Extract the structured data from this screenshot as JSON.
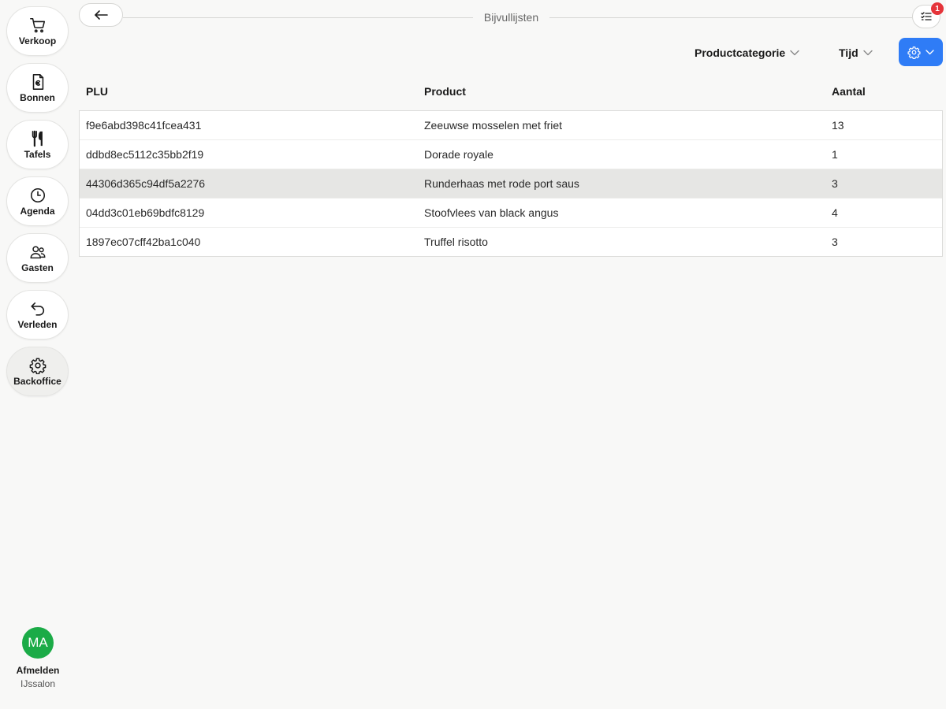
{
  "sidebar": {
    "items": [
      {
        "id": "verkoop",
        "label": "Verkoop",
        "icon": "cart-icon"
      },
      {
        "id": "bonnen",
        "label": "Bonnen",
        "icon": "receipt-euro-icon"
      },
      {
        "id": "tafels",
        "label": "Tafels",
        "icon": "cutlery-icon"
      },
      {
        "id": "agenda",
        "label": "Agenda",
        "icon": "clock-icon"
      },
      {
        "id": "gasten",
        "label": "Gasten",
        "icon": "users-icon"
      },
      {
        "id": "verleden",
        "label": "Verleden",
        "icon": "undo-arrow-icon"
      },
      {
        "id": "backoffice",
        "label": "Backoffice",
        "icon": "gear-icon"
      }
    ],
    "active": "backoffice",
    "user": {
      "initials": "MA",
      "avatar_color": "#1bab47",
      "logout_label": "Afmelden",
      "venue": "IJssalon"
    }
  },
  "header": {
    "title": "Bijvullijsten",
    "notification_count": "1"
  },
  "filters": {
    "category_label": "Productcategorie",
    "time_label": "Tijd"
  },
  "colors": {
    "accent": "#2f7cf6",
    "badge": "#e5343a",
    "avatar": "#1bab47"
  },
  "table": {
    "columns": [
      "PLU",
      "Product",
      "Aantal"
    ],
    "rows": [
      {
        "plu": "f9e6abd398c41fcea431",
        "product": "Zeeuwse mosselen met friet",
        "qty": "13",
        "selected": false
      },
      {
        "plu": "ddbd8ec5112c35bb2f19",
        "product": "Dorade royale",
        "qty": "1",
        "selected": false
      },
      {
        "plu": "44306d365c94df5a2276",
        "product": "Runderhaas met rode port saus",
        "qty": "3",
        "selected": true
      },
      {
        "plu": "04dd3c01eb69bdfc8129",
        "product": "Stoofvlees van black angus",
        "qty": "4",
        "selected": false
      },
      {
        "plu": "1897ec07cff42ba1c040",
        "product": "Truffel risotto",
        "qty": "3",
        "selected": false
      }
    ]
  }
}
